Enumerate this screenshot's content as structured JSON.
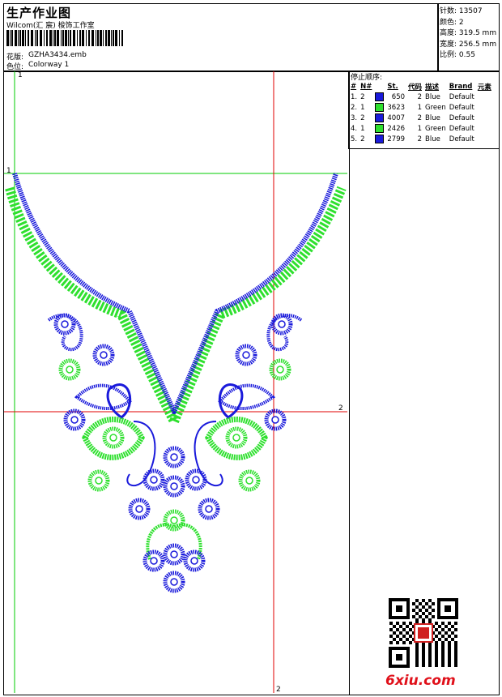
{
  "header": {
    "title": "生产作业图",
    "subtitle": "Wilcom(汇 宸) 梭饰工作室",
    "design_label": "花版:",
    "design_value": "GZHA3434.emb",
    "color_label": "色位:",
    "color_value": "Colorway 1"
  },
  "stats": [
    {
      "label": "针数:",
      "value": "13507"
    },
    {
      "label": "颜色:",
      "value": "2"
    },
    {
      "label": "高度:",
      "value": "319.5 mm"
    },
    {
      "label": "宽度:",
      "value": "256.5 mm"
    },
    {
      "label": "比例:",
      "value": "0.55"
    }
  ],
  "stop_sequence": {
    "title": "停止顺序:",
    "headers": [
      "#",
      "N#",
      "St.",
      "代码",
      "描述",
      "Brand",
      "元素"
    ],
    "rows": [
      {
        "n": "1.",
        "num": "2",
        "color": "#1a1adb",
        "st": "650",
        "code": "2",
        "desc": "Blue",
        "brand": "Default"
      },
      {
        "n": "2.",
        "num": "1",
        "color": "#2ee02e",
        "st": "3623",
        "code": "1",
        "desc": "Green",
        "brand": "Default"
      },
      {
        "n": "3.",
        "num": "2",
        "color": "#1a1adb",
        "st": "4007",
        "code": "2",
        "desc": "Blue",
        "brand": "Default"
      },
      {
        "n": "4.",
        "num": "1",
        "color": "#2ee02e",
        "st": "2426",
        "code": "1",
        "desc": "Green",
        "brand": "Default"
      },
      {
        "n": "5.",
        "num": "2",
        "color": "#1a1adb",
        "st": "2799",
        "code": "2",
        "desc": "Blue",
        "brand": "Default"
      }
    ]
  },
  "guides": {
    "top_mark": "1",
    "left_mark": "1",
    "right_mark": "2",
    "bottom_mark": "2"
  },
  "watermark": "6xiu.com",
  "colors": {
    "blue": "#1a1adb",
    "green": "#2ee02e",
    "guide_red": "#e00000",
    "guide_green": "#00cc00"
  }
}
